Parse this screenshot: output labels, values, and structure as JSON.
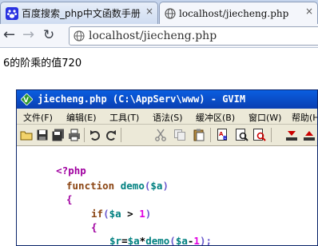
{
  "browser": {
    "tabs": [
      {
        "title": "百度搜索_php中文函数手册",
        "icon": "baidu-paw-icon",
        "active": false
      },
      {
        "title": "localhost/jiecheng.php",
        "icon": "globe-icon",
        "active": true
      }
    ],
    "close_glyph": "×",
    "address": "localhost/jiecheng.php"
  },
  "page": {
    "body_text": "6的阶乘的值720"
  },
  "gvim": {
    "title": "jiecheng.php (C:\\AppServ\\www) - GVIM",
    "menu": [
      "文件(F)",
      "编辑(E)",
      "工具(T)",
      "语法(S)",
      "缓冲区(B)",
      "窗口(W)",
      "帮助(H)"
    ],
    "toolbar_icons": [
      "open-icon",
      "save-icon",
      "save-all-icon",
      "print-icon",
      "undo-icon",
      "redo-icon",
      "cut-icon",
      "copy-icon",
      "paste-icon",
      "replace-icon",
      "find-next-icon",
      "find-prev-icon",
      "load-session-icon",
      "save-session-icon"
    ],
    "code": {
      "line1": {
        "open_tag": "<?php"
      },
      "line2": {
        "kw": "function",
        "name": "demo",
        "open": "(",
        "var": "$a",
        "close": ")"
      },
      "line3": {
        "brace": "{"
      },
      "line4": {
        "kw": "if",
        "open": "(",
        "var": "$a",
        "op": " > ",
        "num": "1",
        "close": ")"
      },
      "line5": {
        "brace": "{"
      },
      "line6": {
        "var1": "$r",
        "eq": "=",
        "var2": "$a",
        "mul": "*",
        "fn": "demo",
        "open": "(",
        "var3": "$a",
        "minus": "-",
        "num": "1",
        "close": ");"
      }
    }
  },
  "colors": {
    "titlebar": "#0a4cc8",
    "php_tag": "#a000a0",
    "keyword": "#8b4513",
    "identifier": "#008080",
    "number": "#e000e0"
  }
}
